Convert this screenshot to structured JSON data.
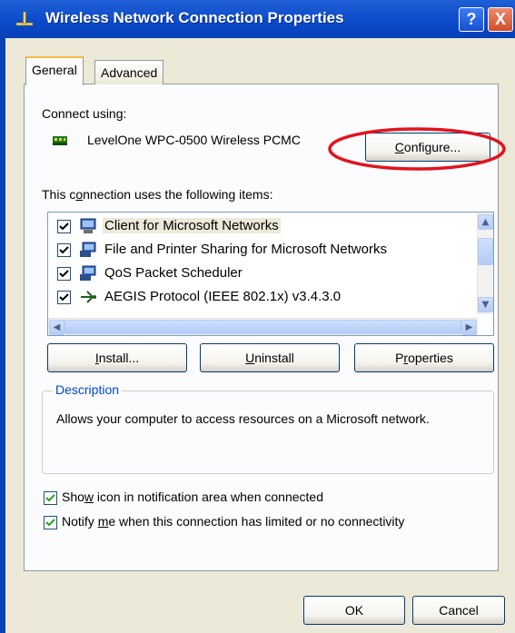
{
  "window": {
    "title": "Wireless Network Connection Properties",
    "help_glyph": "?",
    "close_glyph": "X"
  },
  "tabs": [
    {
      "label": "General",
      "selected": true
    },
    {
      "label": "Advanced",
      "selected": false
    }
  ],
  "connect_using": {
    "label": "Connect using:",
    "adapter": "LevelOne WPC-0500 Wireless PCMC",
    "configure_pre": "",
    "configure_ul": "C",
    "configure_post": "onfigure..."
  },
  "items_section": {
    "label_pre": "This c",
    "label_ul": "o",
    "label_post": "nnection uses the following items:",
    "items": [
      {
        "label": "Client for Microsoft Networks",
        "checked": true,
        "icon": "network-client-icon"
      },
      {
        "label": "File and Printer Sharing for Microsoft Networks",
        "checked": true,
        "icon": "file-printer-sharing-icon"
      },
      {
        "label": "QoS Packet Scheduler",
        "checked": true,
        "icon": "qos-scheduler-icon"
      },
      {
        "label": "AEGIS Protocol (IEEE 802.1x) v3.4.3.0",
        "checked": true,
        "icon": "protocol-icon"
      }
    ]
  },
  "buttons": {
    "install_ul": "I",
    "install_post": "nstall...",
    "uninstall_ul": "U",
    "uninstall_post": "ninstall",
    "properties_pre": "P",
    "properties_ul": "r",
    "properties_post": "operties",
    "ok": "OK",
    "cancel": "Cancel"
  },
  "description": {
    "title": "Description",
    "text": "Allows your computer to access resources on a Microsoft network."
  },
  "options": [
    {
      "pre": "Sho",
      "ul": "w",
      "post": " icon in notification area when connected",
      "checked": true
    },
    {
      "pre": "Notify ",
      "ul": "m",
      "post": "e when this connection has limited or no connectivity",
      "checked": true
    }
  ],
  "colors": {
    "title_bar": "#0a49c9",
    "highlight_ellipse": "#e0141e",
    "group_title": "#0046d5"
  }
}
